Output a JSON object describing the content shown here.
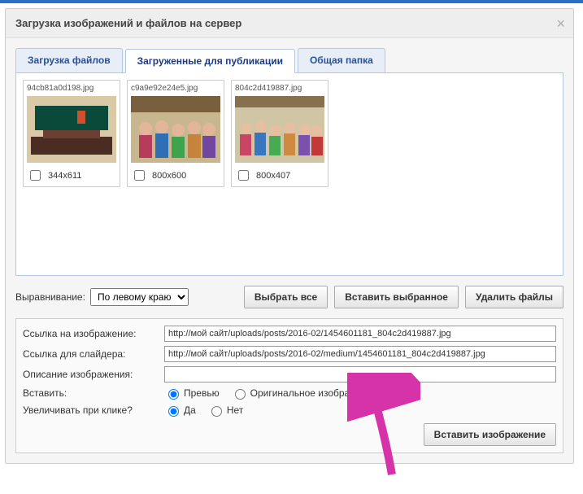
{
  "dialog": {
    "title": "Загрузка изображений и файлов на сервер"
  },
  "tabs": [
    {
      "label": "Загрузка файлов",
      "active": false
    },
    {
      "label": "Загруженные для публикации",
      "active": true
    },
    {
      "label": "Общая папка",
      "active": false
    }
  ],
  "thumbs": [
    {
      "name": "94cb81a0d198.jpg",
      "dims": "344x611"
    },
    {
      "name": "c9a9e92e24e5.jpg",
      "dims": "800x600"
    },
    {
      "name": "804c2d419887.jpg",
      "dims": "800x407"
    }
  ],
  "align": {
    "label": "Выравнивание:",
    "value": "По левому краю"
  },
  "buttons": {
    "select_all": "Выбрать все",
    "insert_selected": "Вставить выбранное",
    "delete_files": "Удалить файлы",
    "insert_image": "Вставить изображение"
  },
  "form": {
    "link_image_label": "Ссылка на изображение:",
    "link_image_value": "http://мой сайт/uploads/posts/2016-02/1454601181_804c2d419887.jpg",
    "link_slider_label": "Ссылка для слайдера:",
    "link_slider_value": "http://мой сайт/uploads/posts/2016-02/medium/1454601181_804c2d419887.jpg",
    "desc_label": "Описание изображения:",
    "desc_value": "",
    "insert_label": "Вставить:",
    "insert_opt_preview": "Превью",
    "insert_opt_original": "Оригинальное изображение",
    "enlarge_label": "Увеличивать при клике?",
    "opt_yes": "Да",
    "opt_no": "Нет"
  }
}
